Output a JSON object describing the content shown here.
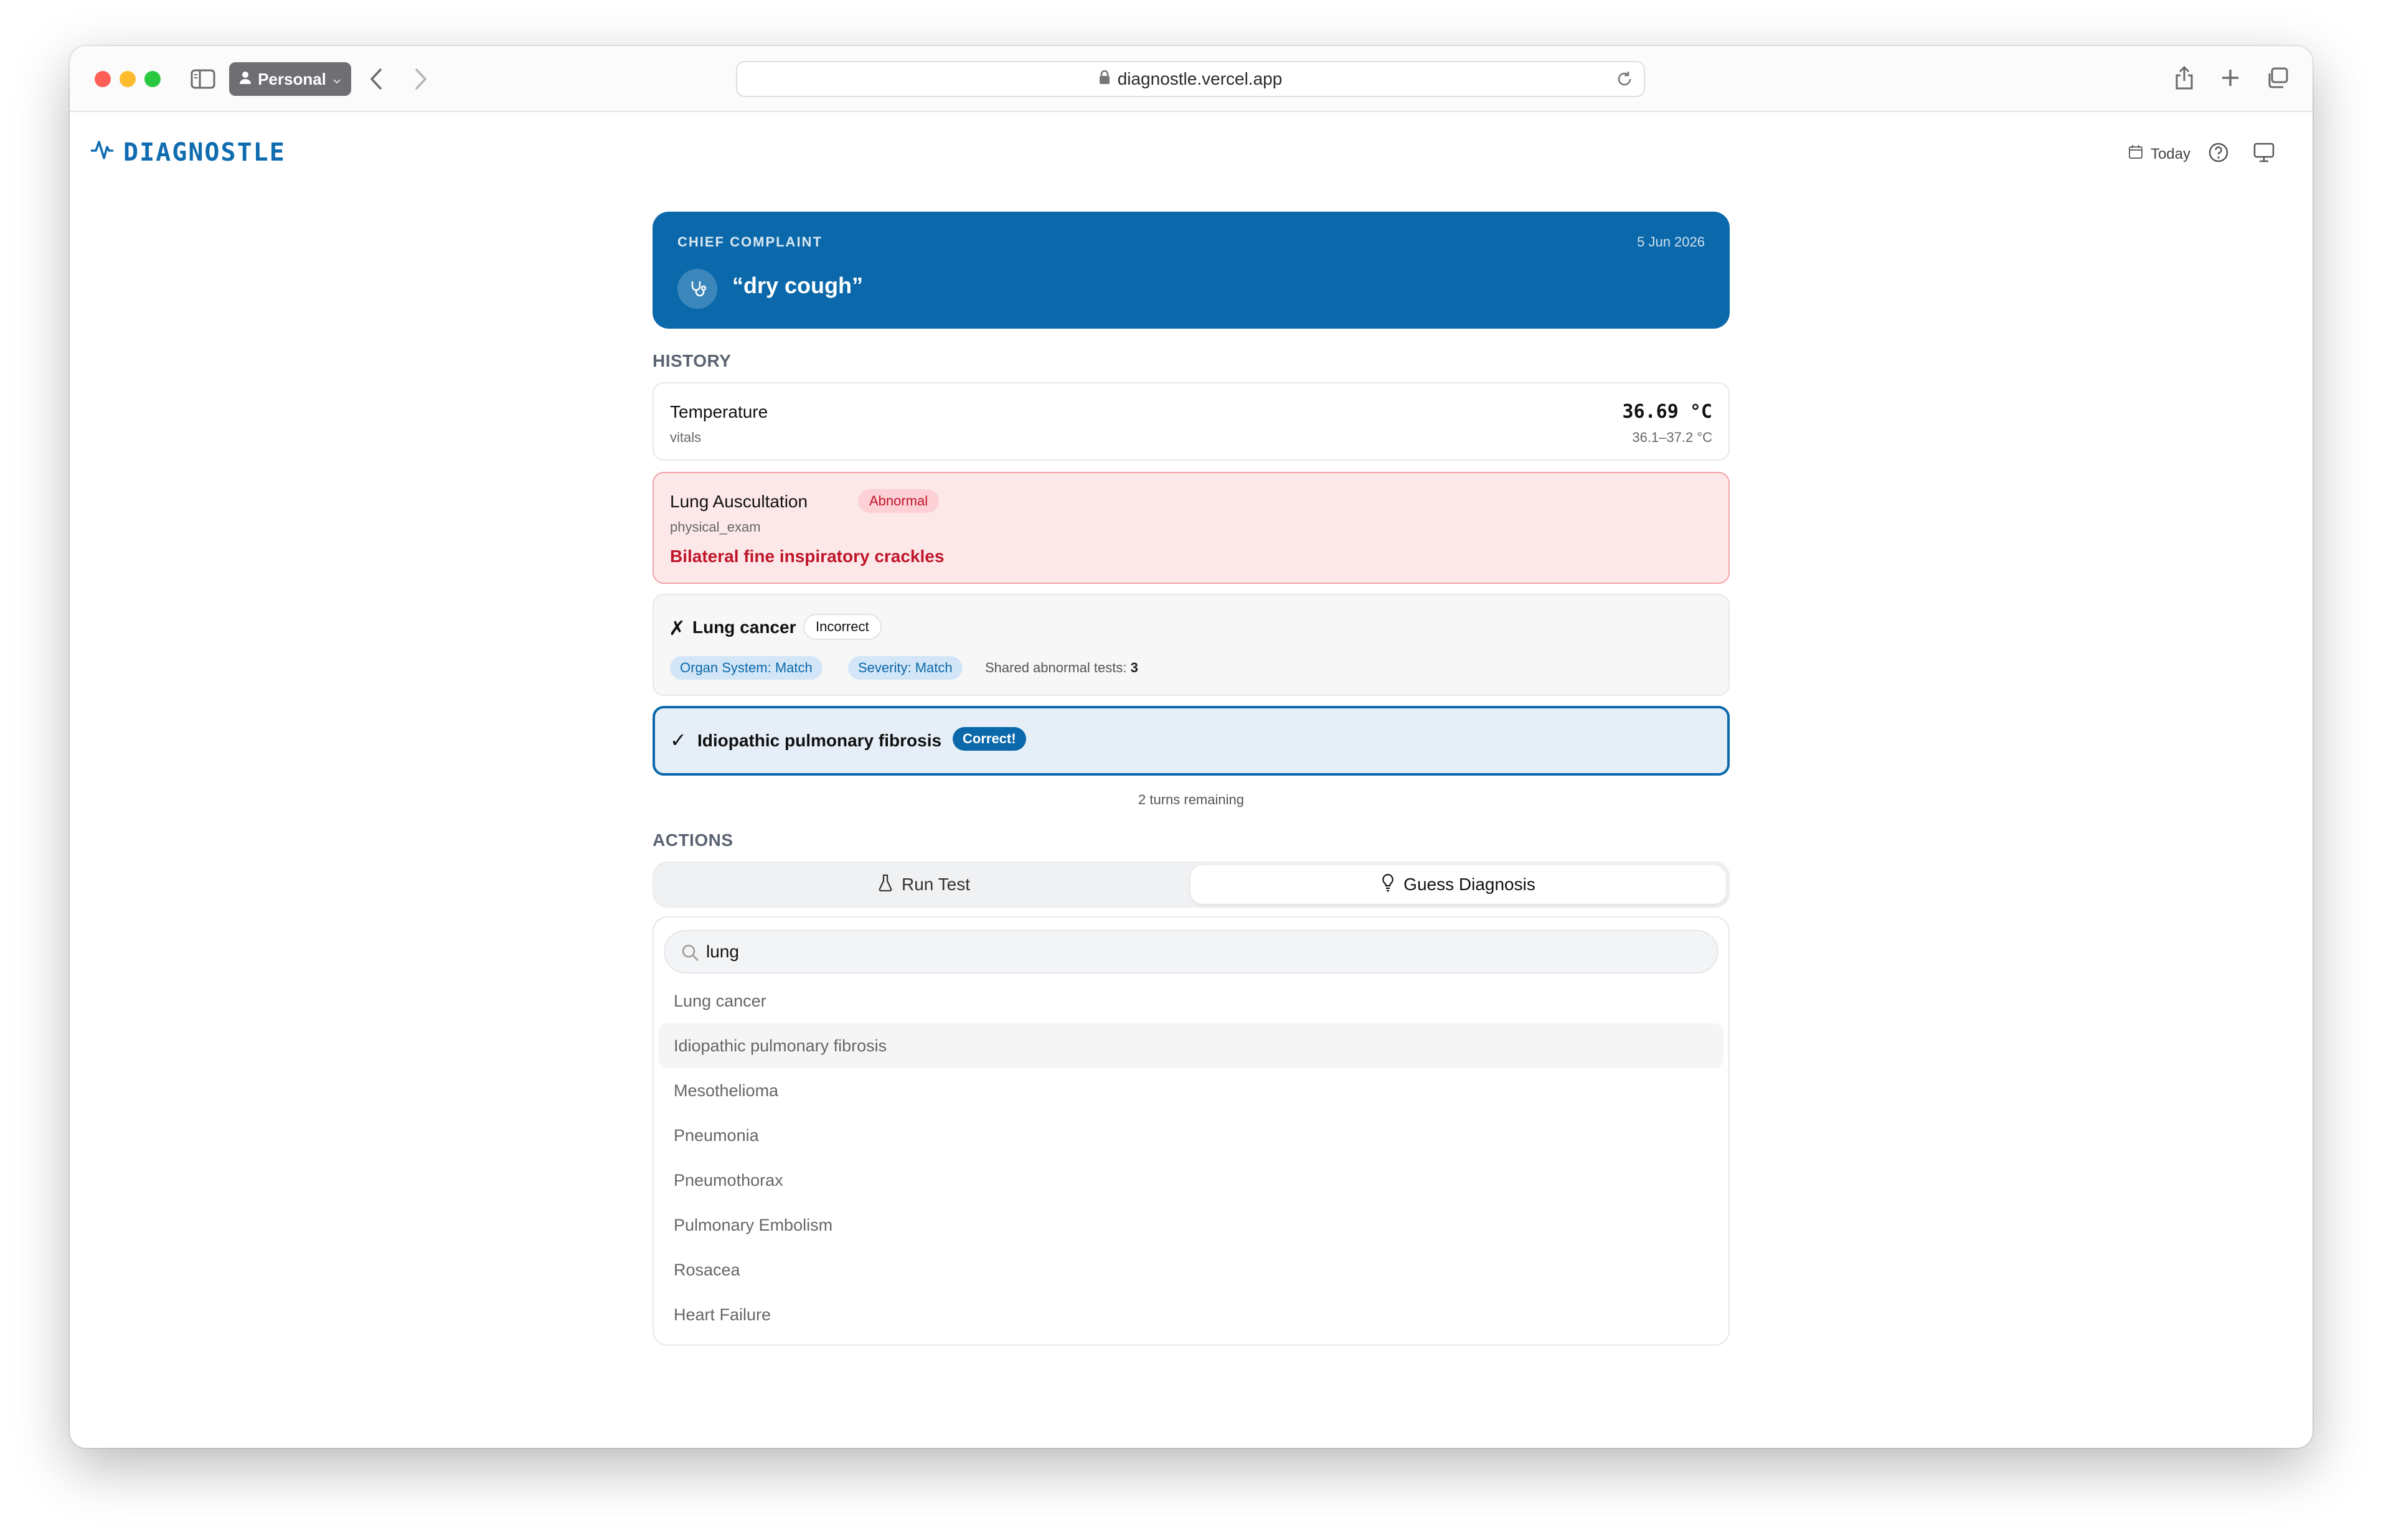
{
  "browser": {
    "profile_label": "Personal",
    "url": "diagnostle.vercel.app"
  },
  "app": {
    "logo_text": "DIAGNOSTLE",
    "today_label": "Today"
  },
  "chief_complaint": {
    "label": "CHIEF COMPLAINT",
    "date": "5 Jun 2026",
    "text": "“dry cough”"
  },
  "history": {
    "title": "HISTORY",
    "temperature": {
      "name": "Temperature",
      "category": "vitals",
      "value": "36.69 °C",
      "range": "36.1–37.2 °C"
    },
    "lung_auscultation": {
      "name": "Lung Auscultation",
      "badge": "Abnormal",
      "category": "physical_exam",
      "finding": "Bilateral fine inspiratory crackles"
    },
    "wrong_guess": {
      "mark": "✗",
      "name": "Lung cancer",
      "badge": "Incorrect",
      "organ_chip": "Organ System: Match",
      "severity_chip": "Severity: Match",
      "shared_label": "Shared abnormal tests:",
      "shared_count": "3"
    },
    "correct_guess": {
      "mark": "✓",
      "name": "Idiopathic pulmonary fibrosis",
      "badge": "Correct!"
    },
    "turns_remaining": "2 turns remaining"
  },
  "actions": {
    "title": "ACTIONS",
    "run_test_label": "Run Test",
    "guess_label": "Guess Diagnosis",
    "search_value": "lung",
    "options": [
      "Lung cancer",
      "Idiopathic pulmonary fibrosis",
      "Mesothelioma",
      "Pneumonia",
      "Pneumothorax",
      "Pulmonary Embolism",
      "Rosacea",
      "Heart Failure"
    ],
    "active_option_index": 1
  },
  "colors": {
    "brand": "#0b69ab",
    "abnormal_bg": "#fde8e9",
    "abnormal_text": "#c0152a"
  }
}
